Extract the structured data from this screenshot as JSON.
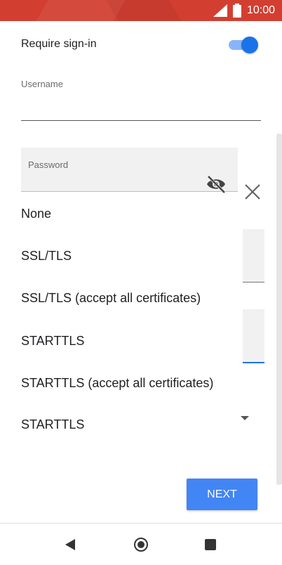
{
  "status_bar": {
    "time": "10:00",
    "icons": [
      "wifi-signal-icon",
      "battery-icon"
    ]
  },
  "settings": {
    "require_signin_label": "Require sign-in",
    "require_signin_enabled": true,
    "username_label": "Username",
    "username_value": "",
    "password_placeholder": "Password",
    "password_toggle_icon": "visibility-off-icon"
  },
  "menu": {
    "close_icon": "close-icon",
    "options": [
      "None",
      "SSL/TLS",
      "SSL/TLS (accept all certificates)",
      "STARTTLS",
      "STARTTLS (accept all certificates)"
    ]
  },
  "security": {
    "selected_value": "STARTTLS",
    "icon": "dropdown-arrow-icon"
  },
  "actions": {
    "next_label": "NEXT"
  },
  "nav": {
    "back_icon": "back-icon",
    "home_icon": "home-icon",
    "recent_icon": "recent-apps-icon"
  },
  "colors": {
    "status_bar": "#d23f31",
    "accent": "#1a73e8",
    "button": "#4285f4"
  }
}
